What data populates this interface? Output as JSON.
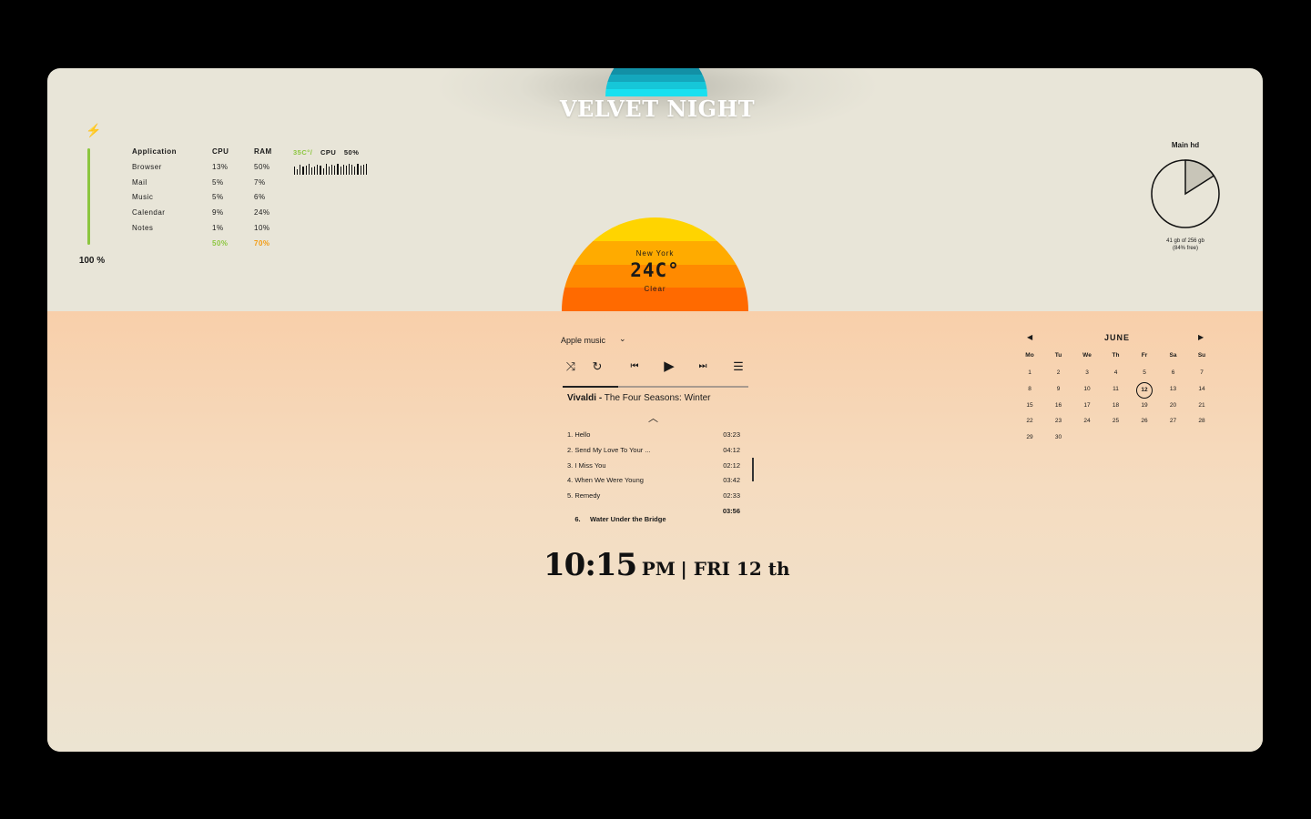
{
  "theme": {
    "title": "VELVET NIGHT",
    "moon_colors": [
      "#0f5f72",
      "#0f6a7e",
      "#107a8e",
      "#1290a6",
      "#14a7bd",
      "#16c6d8",
      "#18e0f0"
    ],
    "sun_colors": [
      "#ffd400",
      "#ffab00",
      "#ff8a00",
      "#ff6a00"
    ],
    "accent_green": "#8cc63f",
    "accent_orange": "#f39c12"
  },
  "battery": {
    "icon": "lightning-bolt-icon",
    "level": "100 %"
  },
  "apps": {
    "headers": {
      "app": "Application",
      "cpu": "CPU",
      "ram": "RAM"
    },
    "rows": [
      {
        "name": "Browser",
        "cpu": "13%",
        "ram": "50%"
      },
      {
        "name": "Mail",
        "cpu": "5%",
        "ram": "7%"
      },
      {
        "name": "Music",
        "cpu": "5%",
        "ram": "6%"
      },
      {
        "name": "Calendar",
        "cpu": "9%",
        "ram": "24%"
      },
      {
        "name": "Notes",
        "cpu": "1%",
        "ram": "10%"
      }
    ],
    "totals": {
      "cpu": "50%",
      "ram": "70%"
    }
  },
  "cpu_monitor": {
    "temp": "35C°/",
    "label": "CPU",
    "usage": "50%"
  },
  "disk": {
    "title": "Main hd",
    "used_fraction": 0.16,
    "line1": "41 gb of 256 gb",
    "line2": "(84% free)"
  },
  "weather": {
    "city": "New York",
    "temp": "24C°",
    "condition": "Clear"
  },
  "music": {
    "source": "Apple music",
    "progress": 0.3,
    "artist": "Vivaldi -",
    "song": "The Four Seasons: Winter",
    "tracks": [
      {
        "title": "1. Hello",
        "duration": "03:23"
      },
      {
        "title": "2. Send My Love To Your ...",
        "duration": "04:12"
      },
      {
        "title": "3. I Miss You",
        "duration": "02:12"
      },
      {
        "title": "4. When We Were Young",
        "duration": "03:42"
      },
      {
        "title": "5. Remedy",
        "duration": "02:33"
      },
      {
        "title": "6.     Water Under the Bridge",
        "duration": "03:56"
      }
    ]
  },
  "clock": {
    "time": "10:15",
    "ampm": "PM",
    "date": "| FRI 12 th"
  },
  "calendar": {
    "month": "JUNE",
    "weekdays": [
      "Mo",
      "Tu",
      "We",
      "Th",
      "Fr",
      "Sa",
      "Su"
    ],
    "first_weekday_index": 0,
    "days": 30,
    "today": 12
  }
}
